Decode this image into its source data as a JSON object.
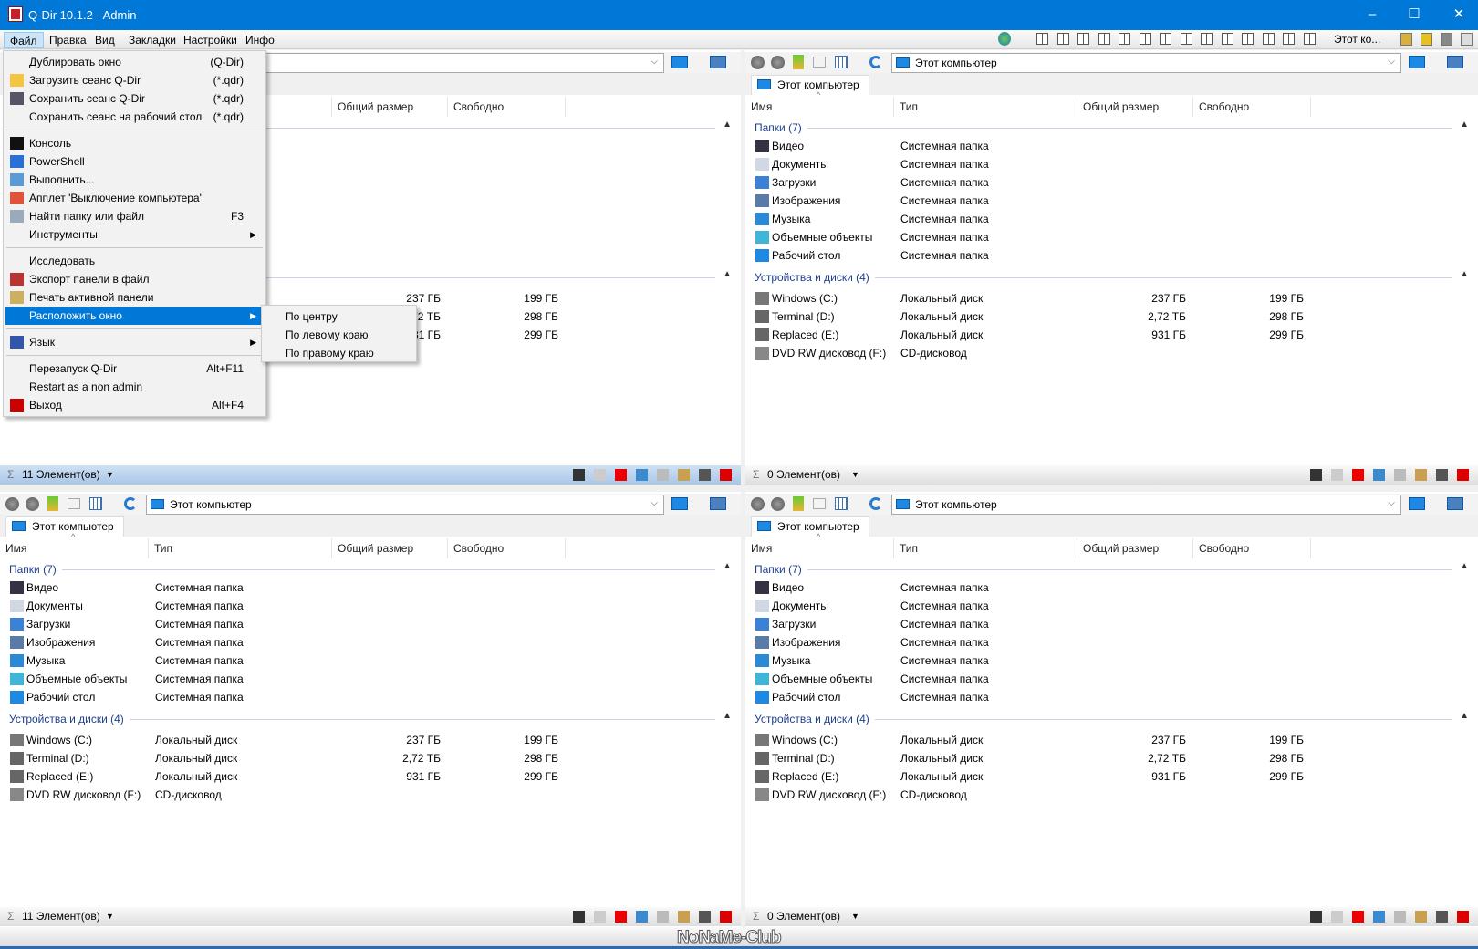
{
  "window": {
    "title": "Q-Dir 10.1.2 - Admin",
    "minimize": "–",
    "maximize": "☐",
    "close": "✕"
  },
  "menubar": {
    "items": [
      "Файл",
      "Правка",
      "Вид",
      "Закладки",
      "Настройки",
      "Инфо"
    ],
    "open_item": "Файл",
    "quick_label": "Этот ко..."
  },
  "file_menu": {
    "items": [
      {
        "label": "Дублировать окно",
        "shortcut": "(Q-Dir)",
        "icon": ""
      },
      {
        "label": "Загрузить сеанс Q-Dir",
        "shortcut": "(*.qdr)",
        "icon": "folder-icon"
      },
      {
        "label": "Сохранить сеанс Q-Dir",
        "shortcut": "(*.qdr)",
        "icon": "floppy-disk-icon"
      },
      {
        "label": "Сохранить сеанс на рабочий стол",
        "shortcut": "(*.qdr)",
        "icon": ""
      },
      {
        "sep": true
      },
      {
        "label": "Консоль",
        "shortcut": "",
        "icon": "console-icon"
      },
      {
        "label": "PowerShell",
        "shortcut": "",
        "icon": "powershell-icon"
      },
      {
        "label": "Выполнить...",
        "shortcut": "",
        "icon": "run-icon"
      },
      {
        "label": "Апплет 'Выключение компьютера'",
        "shortcut": "",
        "icon": "power-icon"
      },
      {
        "label": "Найти папку или файл",
        "shortcut": "F3",
        "icon": "search-icon"
      },
      {
        "label": "Инструменты",
        "shortcut": "",
        "icon": "",
        "submenu": true
      },
      {
        "sep": true
      },
      {
        "label": "Исследовать",
        "shortcut": "",
        "icon": ""
      },
      {
        "label": "Экспорт панели в файл",
        "shortcut": "",
        "icon": "export-icon"
      },
      {
        "label": "Печать активной панели",
        "shortcut": "",
        "icon": "printer-icon"
      },
      {
        "label": "Расположить окно",
        "shortcut": "",
        "icon": "",
        "submenu": true,
        "highlighted": true
      },
      {
        "sep": true
      },
      {
        "label": "Язык",
        "shortcut": "",
        "icon": "language-flag-icon",
        "submenu": true
      },
      {
        "sep": true
      },
      {
        "label": "Перезапуск Q-Dir",
        "shortcut": "Alt+F11",
        "icon": ""
      },
      {
        "label": "Restart as a non admin",
        "shortcut": "",
        "icon": ""
      },
      {
        "label": "Выход",
        "shortcut": "Alt+F4",
        "icon": "exit-icon"
      }
    ]
  },
  "position_submenu": {
    "items": [
      "По центру",
      "По левому  краю",
      "По правому  краю"
    ]
  },
  "listing": {
    "columns": [
      "Имя",
      "Тип",
      "Общий размер",
      "Свободно"
    ],
    "groups": [
      {
        "label": "Папки (7)",
        "items": [
          {
            "name": "Видео",
            "type": "Системная папка",
            "size": "",
            "free": "",
            "icon": "video-folder-icon"
          },
          {
            "name": "Документы",
            "type": "Системная папка",
            "size": "",
            "free": "",
            "icon": "documents-folder-icon"
          },
          {
            "name": "Загрузки",
            "type": "Системная папка",
            "size": "",
            "free": "",
            "icon": "downloads-folder-icon"
          },
          {
            "name": "Изображения",
            "type": "Системная папка",
            "size": "",
            "free": "",
            "icon": "pictures-folder-icon"
          },
          {
            "name": "Музыка",
            "type": "Системная папка",
            "size": "",
            "free": "",
            "icon": "music-folder-icon"
          },
          {
            "name": "Объемные объекты",
            "type": "Системная папка",
            "size": "",
            "free": "",
            "icon": "3d-objects-folder-icon"
          },
          {
            "name": "Рабочий стол",
            "type": "Системная папка",
            "size": "",
            "free": "",
            "icon": "desktop-folder-icon"
          }
        ]
      },
      {
        "label": "Устройства и диски (4)",
        "items": [
          {
            "name": "Windows (C:)",
            "type": "Локальный диск",
            "size": "237 ГБ",
            "free": "199 ГБ",
            "icon": "system-drive-icon"
          },
          {
            "name": "Terminal (D:)",
            "type": "Локальный диск",
            "size": "2,72 ТБ",
            "free": "298 ГБ",
            "icon": "drive-icon"
          },
          {
            "name": "Replaced (E:)",
            "type": "Локальный диск",
            "size": "931 ГБ",
            "free": "299 ГБ",
            "icon": "drive-icon"
          },
          {
            "name": "DVD RW дисковод (F:)",
            "type": "CD-дисковод",
            "size": "",
            "free": "",
            "icon": "dvd-drive-icon"
          }
        ]
      }
    ]
  },
  "panes": [
    {
      "name": "top-left",
      "address": "Этот компьютер",
      "tab": "",
      "status": "11 Элемент(ов)",
      "active": true
    },
    {
      "name": "top-right",
      "address": "Этот компьютер",
      "tab": "Этот компьютер",
      "status": "0 Элемент(ов)",
      "active": false
    },
    {
      "name": "bottom-left",
      "address": "Этот компьютер",
      "tab": "Этот компьютер",
      "status": "11 Элемент(ов)",
      "active": false
    },
    {
      "name": "bottom-right",
      "address": "Этот компьютер",
      "tab": "Этот компьютер",
      "status": "0 Элемент(ов)",
      "active": false
    }
  ],
  "watermark": "NoNaMe-Club",
  "colors": {
    "titlebar": "#0078d7",
    "highlight": "#0078d7",
    "group_text": "#1e3f8f",
    "active_status": "#bcd5ee"
  }
}
